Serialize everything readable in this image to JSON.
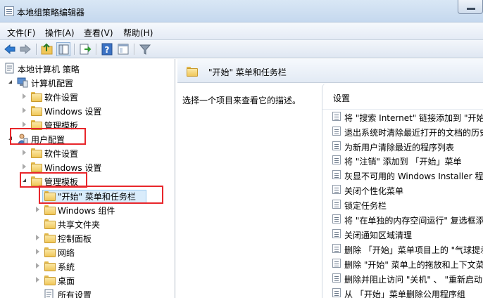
{
  "window": {
    "title": "本地组策略编辑器"
  },
  "menu": [
    "文件(F)",
    "操作(A)",
    "查看(V)",
    "帮助(H)"
  ],
  "toolbar": [
    "back-icon",
    "forward-icon",
    "up-folder-icon",
    "show-tree-icon",
    "export-icon",
    "help-icon",
    "properties-icon",
    "filter-icon"
  ],
  "tree": {
    "root": "本地计算机 策略",
    "computer_config": "计算机配置",
    "cc_software": "软件设置",
    "cc_windows": "Windows 设置",
    "cc_admin": "管理模板",
    "user_config": "用户配置",
    "uc_software": "软件设置",
    "uc_windows": "Windows 设置",
    "uc_admin": "管理模板",
    "start_menu": "\"开始\" 菜单和任务栏",
    "windows_components": "Windows 组件",
    "shared_folders": "共享文件夹",
    "control_panel": "控制面板",
    "network": "网络",
    "system": "系统",
    "desktop": "桌面",
    "all_settings": "所有设置"
  },
  "right_pane": {
    "header_title": "\"开始\" 菜单和任务栏",
    "description": "选择一个项目来查看它的描述。",
    "settings_column": "设置",
    "settings": [
      "将 \"搜索 Internet\" 链接添加到 \"开始",
      "退出系统时清除最近打开的文档的历史",
      "为新用户清除最近的程序列表",
      "将 \"注销\" 添加到 「开始」菜单",
      "灰显不可用的 Windows Installer 程序",
      "关闭个性化菜单",
      "锁定任务栏",
      "将 \"在单独的内存空间运行\" 复选框添",
      "关闭通知区域清理",
      "删除 「开始」菜单项目上的 \"气球提示",
      "删除 \"开始\" 菜单上的拖放和上下文菜",
      "删除并阻止访问 \"关机\" 、 \"重新启动",
      "从 「开始」菜单删除公用程序组"
    ]
  }
}
